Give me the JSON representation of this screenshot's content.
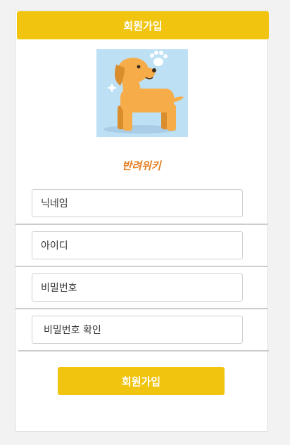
{
  "header": {
    "title": "회원가입"
  },
  "brand": {
    "name": "반려위키"
  },
  "fields": [
    {
      "placeholder": "닉네임"
    },
    {
      "placeholder": "아이디"
    },
    {
      "placeholder": "비밀번호"
    },
    {
      "placeholder": "비밀번호 확인"
    }
  ],
  "submit": {
    "label": "회원가입"
  },
  "colors": {
    "accent": "#f1c40f",
    "brand": "#e67e22",
    "illustration_bg": "#bde0f5",
    "dog": "#f6ad49"
  }
}
